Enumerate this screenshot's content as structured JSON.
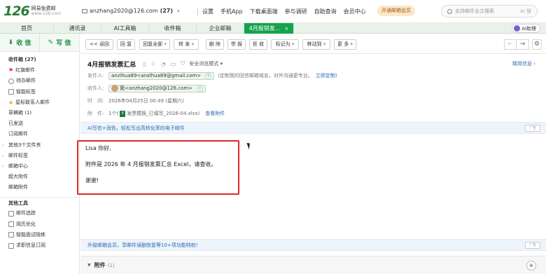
{
  "logo": {
    "number": "126",
    "name": "网易免费邮",
    "domain": "www.126.com"
  },
  "account": {
    "email": "anzhang2020@126.com",
    "count": "(27)"
  },
  "topnav": [
    "设置",
    "手机App",
    "下载桌面端",
    "参与调研",
    "自助查询",
    "会员中心"
  ],
  "vip_button": "开通邮箱会员",
  "search": {
    "placeholder": "支持邮件全文搜索",
    "ai": "AI 搜"
  },
  "tabs": [
    {
      "label": "首页"
    },
    {
      "label": "通讯录"
    },
    {
      "label": "AI工具箱"
    },
    {
      "label": "收件箱"
    },
    {
      "label": "企业邮箱"
    },
    {
      "label": "4月报销发...",
      "close": "×"
    }
  ],
  "ai_helper": "AI助理",
  "sidebar": {
    "receive": "收 信",
    "write": "写 信",
    "items": [
      {
        "label": "收件箱 (27)",
        "icon": "",
        "bold": true
      },
      {
        "label": "红旗邮件",
        "icon": "flag-icon"
      },
      {
        "label": "待办邮件",
        "icon": "clock-icon"
      },
      {
        "label": "智能标签",
        "icon": "tag-icon"
      },
      {
        "label": "星标联系人邮件",
        "icon": "star-icon"
      },
      {
        "label": "草稿箱 (1)",
        "icon": ""
      },
      {
        "label": "已发送",
        "icon": ""
      },
      {
        "label": "订阅邮件",
        "icon": ""
      },
      {
        "label": "其他3个文件夹",
        "icon": "",
        "arrow": true
      },
      {
        "label": "邮件标签",
        "icon": "",
        "arrow": true
      },
      {
        "label": "邮箱中心",
        "icon": "",
        "arrow": true
      },
      {
        "label": "超大附件",
        "icon": ""
      },
      {
        "label": "邮箱附件",
        "icon": ""
      }
    ],
    "tools_title": "其他工具",
    "tools": [
      {
        "label": "邮件追踪",
        "icon": "track-icon"
      },
      {
        "label": "简历优化",
        "icon": "resume-icon"
      },
      {
        "label": "智能面试陪练",
        "icon": "interview-icon"
      },
      {
        "label": "求职信息订阅",
        "icon": "subscribe-icon"
      }
    ]
  },
  "toolbar": {
    "back": "<< 返回",
    "reply": "回 复",
    "reply_all": "回复全部",
    "forward": "转 发",
    "delete": "删 除",
    "report": "举 报",
    "reject": "拒 收",
    "mark_as": "标记为",
    "move_to": "移动到",
    "more": "更 多"
  },
  "mail": {
    "subject": "4月报销发票汇总",
    "safe_mode": "安全浏览模式",
    "brief": "精简信息",
    "from_label": "发件人:",
    "from": "anzihua89<anzihua89@gmail.com>",
    "from_note": "(定制我的回信邮箱域名，对外沟通更专业。",
    "from_link": "立即定制",
    "from_note_end": ")",
    "to_label": "收件人:",
    "to": "我<anzhang2020@126.com>",
    "time_label": "时　间:",
    "time": "2026年04月25日 00:49 (星期六)",
    "attach_label": "附　件:",
    "attach_count": "1个(",
    "attach_name": "发票模板_已填写_2026-04.xlsx",
    "attach_end": ")",
    "view_attach": "查看附件"
  },
  "ai_banner": "AI写信+润色，轻松写出高转化率的电子邮件",
  "ad_tag": "广告",
  "body": {
    "greeting": "Lisa 你好,",
    "line": "附件是 2026 年 4 月报销发票汇总 Excel，请查收。",
    "thanks": "谢谢!"
  },
  "upgrade_banner": "升级邮箱会员，享邮件误删恢复等10+项功能特权!",
  "attachments": {
    "label": "附件",
    "count": "(1)"
  }
}
